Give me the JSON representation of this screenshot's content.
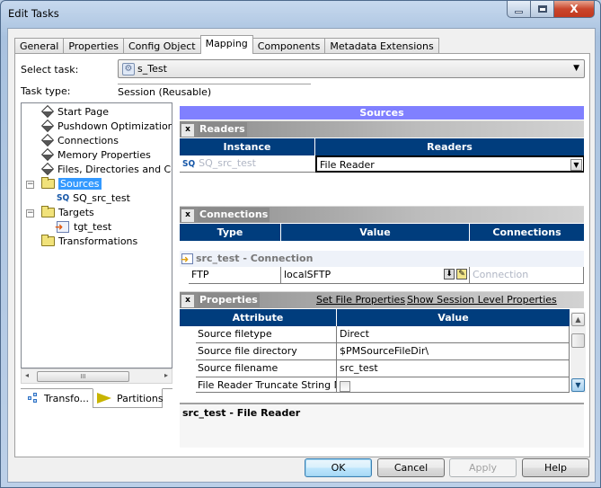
{
  "window": {
    "title": "Edit Tasks",
    "caption_buttons": [
      "minimize",
      "maximize",
      "close"
    ],
    "close_glyph": "X"
  },
  "tabs": [
    {
      "label": "General",
      "active": false
    },
    {
      "label": "Properties",
      "active": false
    },
    {
      "label": "Config Object",
      "active": false
    },
    {
      "label": "Mapping",
      "active": true
    },
    {
      "label": "Components",
      "active": false
    },
    {
      "label": "Metadata Extensions",
      "active": false
    }
  ],
  "task": {
    "select_label": "Select task:",
    "selected_value": "s_Test",
    "type_label": "Task type:",
    "type_value": "Session (Reusable)"
  },
  "tree": {
    "items": [
      {
        "label": "Start Page",
        "icon": "diamond-icon"
      },
      {
        "label": "Pushdown Optimization",
        "icon": "diamond-icon"
      },
      {
        "label": "Connections",
        "icon": "diamond-icon"
      },
      {
        "label": "Memory Properties",
        "icon": "diamond-icon"
      },
      {
        "label": "Files, Directories and Commands",
        "icon": "diamond-icon"
      },
      {
        "label": "Sources",
        "icon": "folder-icon",
        "expanded": true,
        "selected": true
      },
      {
        "label": "SQ_src_test",
        "icon": "source-qualifier-icon"
      },
      {
        "label": "Targets",
        "icon": "folder-icon",
        "expanded": true
      },
      {
        "label": "tgt_test",
        "icon": "target-icon"
      },
      {
        "label": "Transformations",
        "icon": "folder-icon"
      }
    ],
    "expander_glyph": "−",
    "sq_glyph": "SQ",
    "scroll_left": "◂",
    "scroll_right": "▸",
    "scroll_grip": "III"
  },
  "bottom_tabs": [
    {
      "label": "Transfo...",
      "active": false
    },
    {
      "label": "Partitions",
      "active": true
    }
  ],
  "right": {
    "header": "Sources",
    "collapse_glyph": "x",
    "readers": {
      "title": "Readers",
      "columns": [
        "Instance",
        "Readers"
      ],
      "rows": [
        {
          "instance": "SQ_src_test",
          "reader": "File Reader"
        }
      ]
    },
    "connections": {
      "title": "Connections",
      "columns": [
        "Type",
        "Value",
        "Connections"
      ],
      "group": "src_test - Connection",
      "rows": [
        {
          "type": "FTP",
          "value": "localSFTP",
          "connection": "Connection"
        }
      ]
    },
    "properties": {
      "title": "Properties",
      "links": [
        "Set File Properties",
        "Show Session Level Properties"
      ],
      "columns": [
        "Attribute",
        "Value"
      ],
      "rows": [
        {
          "attribute": "Source filetype",
          "value": "Direct"
        },
        {
          "attribute": "Source file directory",
          "value": "$PMSourceFileDir\\"
        },
        {
          "attribute": "Source filename",
          "value": "src_test"
        },
        {
          "attribute": "File Reader Truncate String Null",
          "value": "",
          "checkbox": true,
          "checked": false
        }
      ]
    },
    "description": "src_test - File Reader"
  },
  "buttons": {
    "ok": "OK",
    "cancel": "Cancel",
    "apply": "Apply",
    "help": "Help"
  }
}
